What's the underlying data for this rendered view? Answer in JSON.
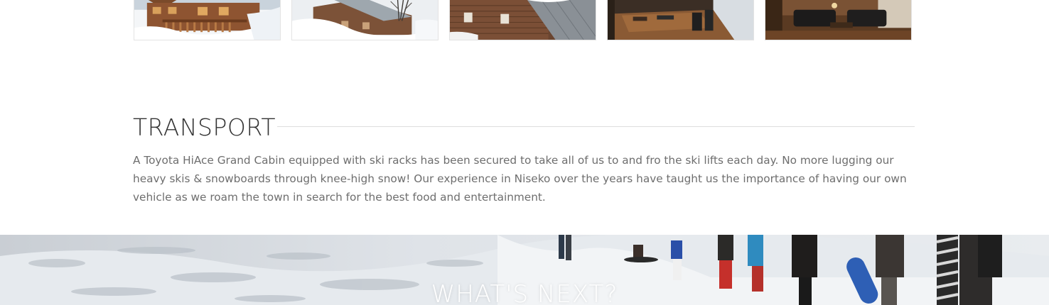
{
  "gallery": {
    "thumbnails": [
      {
        "icon": "chalet-exterior-photo"
      },
      {
        "icon": "snowy-roof-photo"
      },
      {
        "icon": "wooden-lodge-photo"
      },
      {
        "icon": "dining-room-photo"
      },
      {
        "icon": "living-room-photo"
      }
    ]
  },
  "transport": {
    "title": "TRANSPORT",
    "body": "A Toyota HiAce Grand Cabin equipped with ski racks has been secured to take all of us to and fro the ski lifts each day. No more lugging our heavy skis & snowboards through knee-high snow! Our experience in Niseko over the years have taught us the importance of having our own vehicle as we roam the town in search for the best food and entertainment."
  },
  "hero": {
    "title": "WHAT'S NEXT?",
    "image": "skiers-on-snow-photo"
  },
  "colors": {
    "heading": "#333333",
    "body_text": "#6e6e6e",
    "rule": "#dddddd",
    "hero_title": "#ffffff"
  }
}
